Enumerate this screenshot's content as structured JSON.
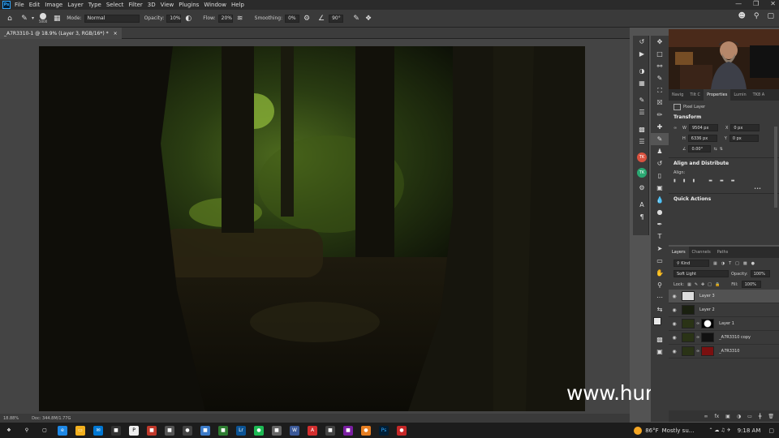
{
  "app": {
    "logo": "Ps"
  },
  "menu": [
    "File",
    "Edit",
    "Image",
    "Layer",
    "Type",
    "Select",
    "Filter",
    "3D",
    "View",
    "Plugins",
    "Window",
    "Help"
  ],
  "options": {
    "brush_size": "5000",
    "mode_label": "Mode:",
    "mode_value": "Normal",
    "opacity_label": "Opacity:",
    "opacity_value": "10%",
    "flow_label": "Flow:",
    "flow_value": "20%",
    "smoothing_label": "Smoothing:",
    "smoothing_value": "0%",
    "angle_value": "90°"
  },
  "document": {
    "tab_title": "_A7R3310-1 @ 18.9% (Layer 3, RGB/16*) *",
    "close_glyph": "×"
  },
  "status": {
    "zoom": "18.88%",
    "doc": "Doc: 344.8M/1.77G"
  },
  "watermark": "www.hunls.com",
  "properties": {
    "tabs": [
      "Navig",
      "Tilt C",
      "Properties",
      "Lumin",
      "TK8 A"
    ],
    "layer_type": "Pixel Layer",
    "transform_title": "Transform",
    "w_label": "W",
    "w_value": "9504 px",
    "x_label": "X",
    "x_value": "0 px",
    "h_label": "H",
    "h_value": "6336 px",
    "y_label": "Y",
    "y_value": "0 px",
    "angle_value": "0.00°",
    "align_title": "Align and Distribute",
    "align_label": "Align:",
    "more": "•••",
    "quick_title": "Quick Actions"
  },
  "layers": {
    "tabs": [
      "Layers",
      "Channels",
      "Paths"
    ],
    "kind_label": "Kind",
    "blend_mode": "Soft Light",
    "opacity_label": "Opacity:",
    "opacity_value": "100%",
    "lock_label": "Lock:",
    "fill_label": "Fill:",
    "fill_value": "100%",
    "items": [
      {
        "name": "Layer 3"
      },
      {
        "name": "Layer 2"
      },
      {
        "name": "Layer 1"
      },
      {
        "name": "_A7R3310 copy"
      },
      {
        "name": "_A7R3310"
      }
    ]
  },
  "taskbar": {
    "weather_temp": "86°F",
    "weather_desc": "Mostly su...",
    "time": "9:18 AM"
  }
}
